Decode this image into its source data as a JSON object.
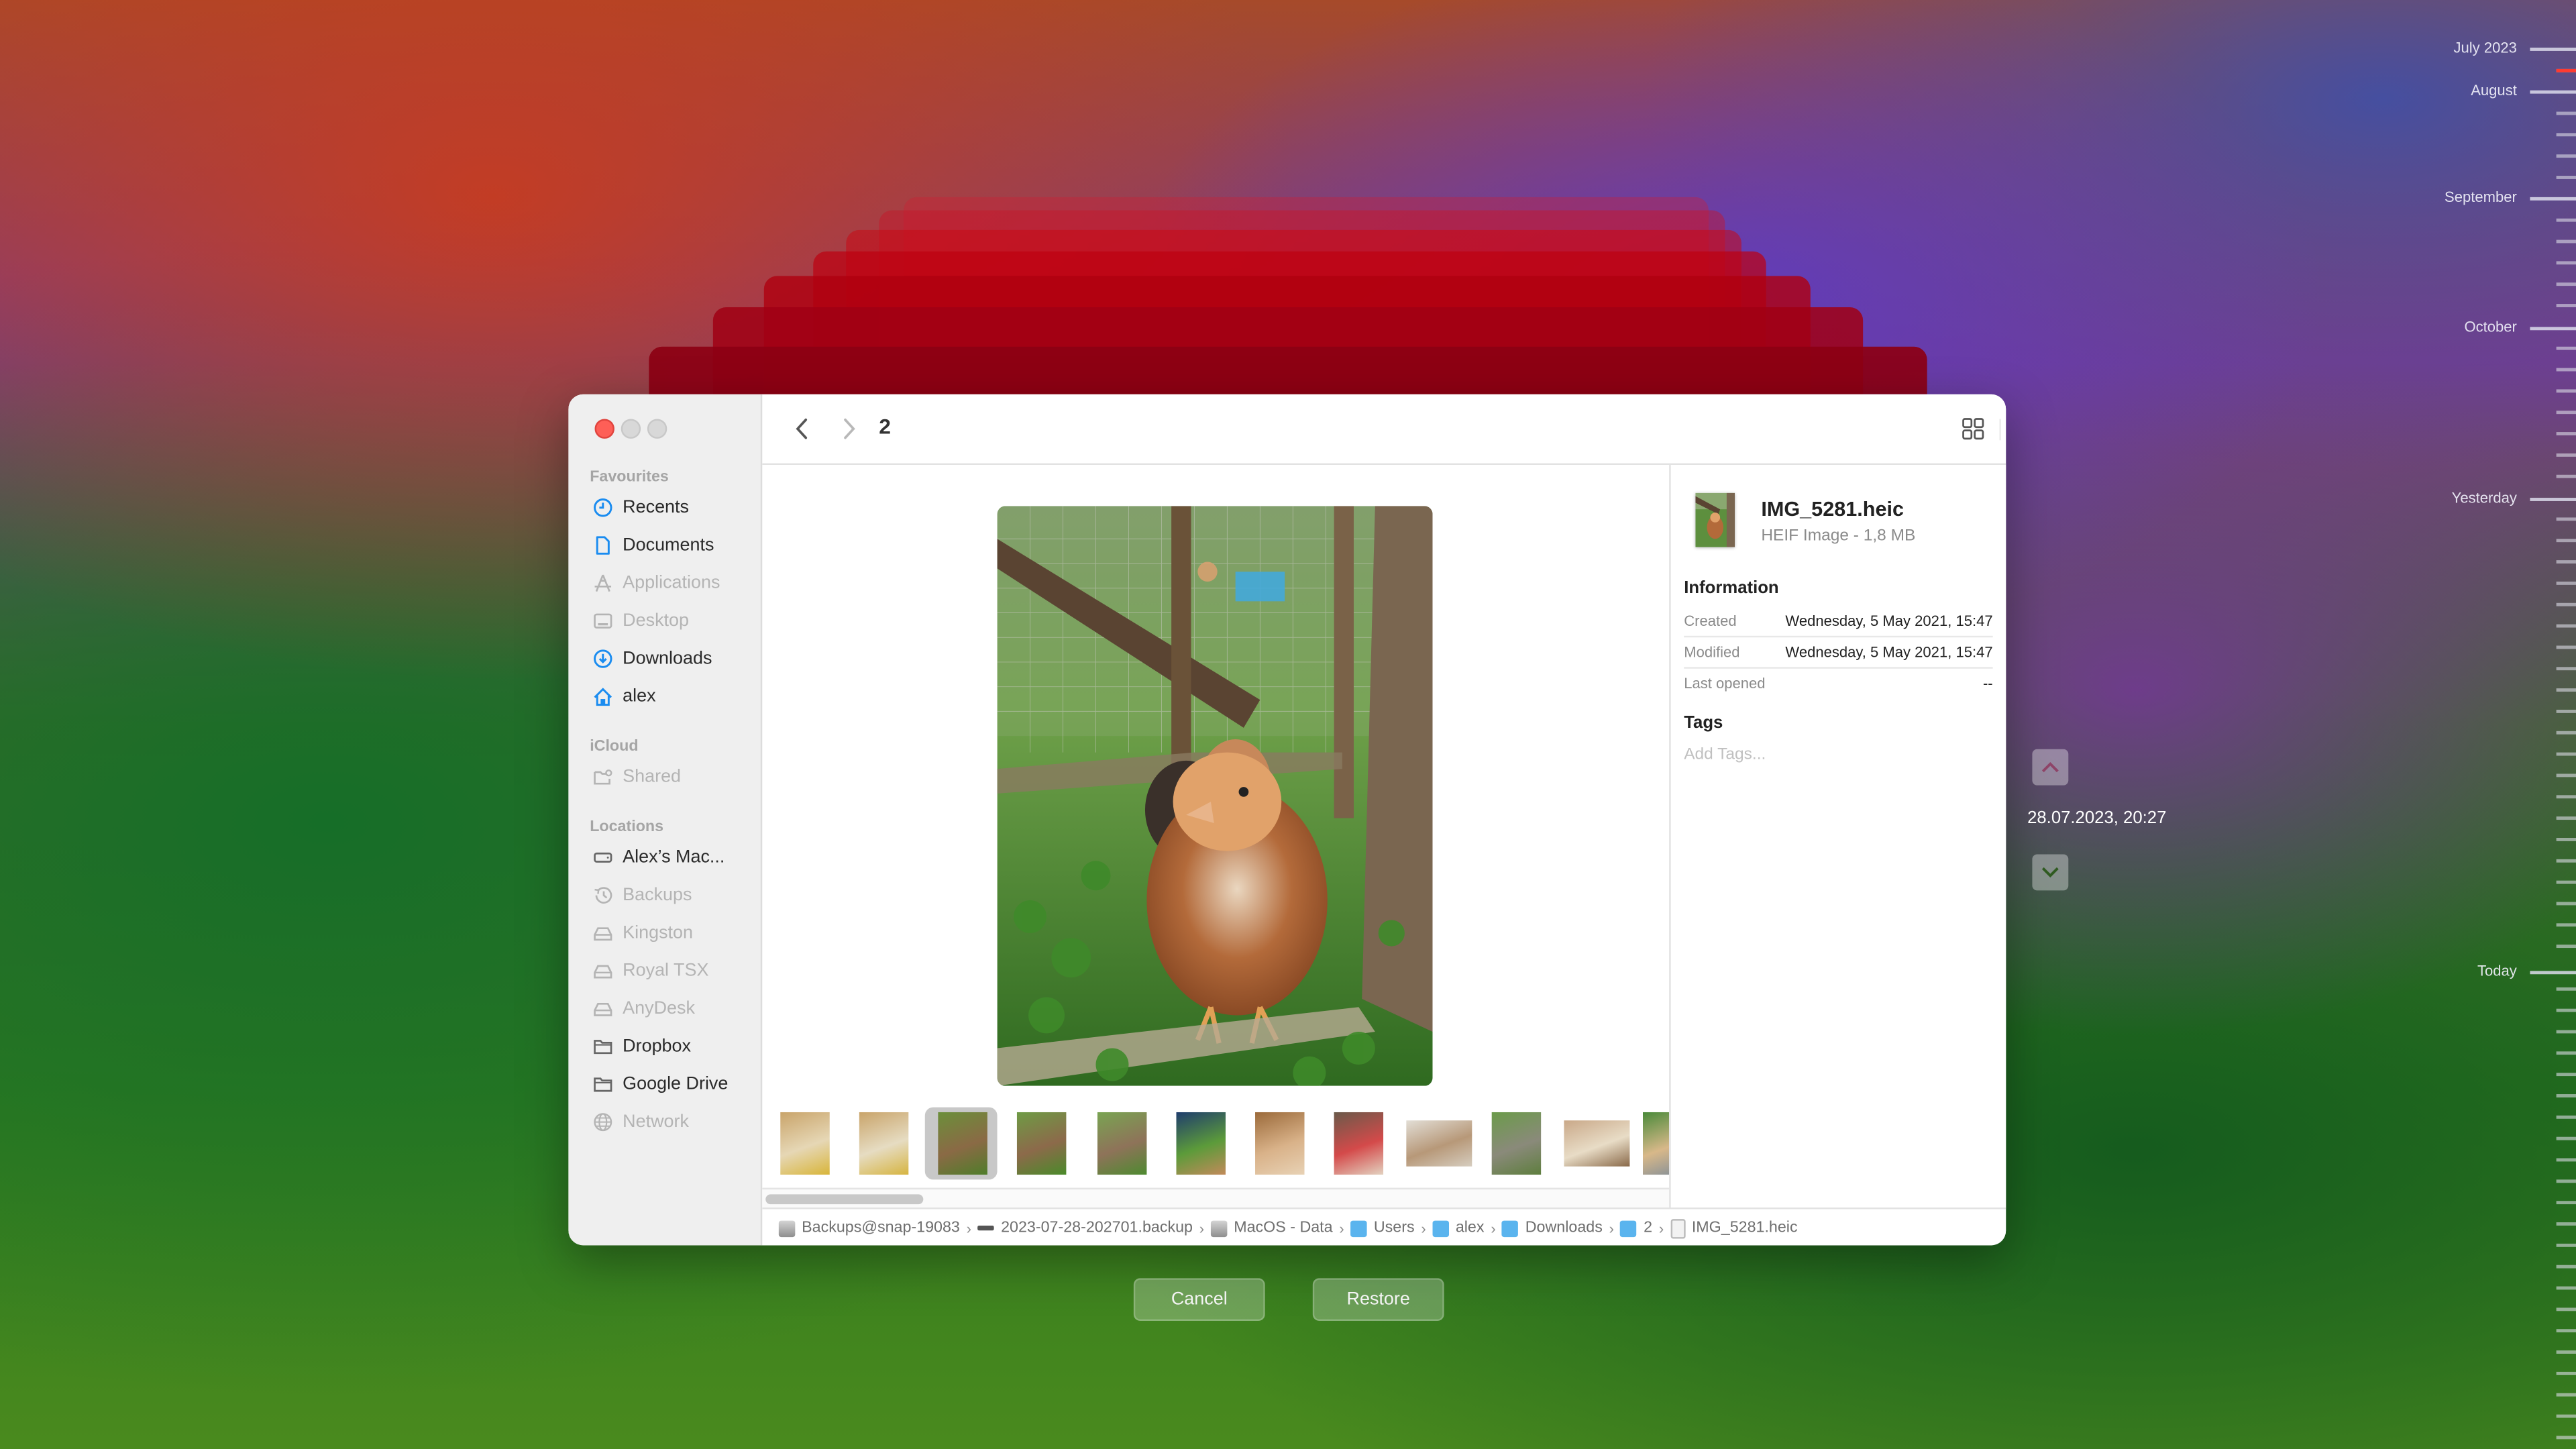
{
  "window": {
    "folder_title": "2",
    "controls": [
      "close",
      "minimize",
      "zoom"
    ]
  },
  "sidebar": {
    "sections": [
      {
        "heading": "Favourites",
        "items": [
          {
            "label": "Recents",
            "icon": "clock-icon",
            "enabled": true
          },
          {
            "label": "Documents",
            "icon": "document-icon",
            "enabled": true
          },
          {
            "label": "Applications",
            "icon": "applications-icon",
            "enabled": false
          },
          {
            "label": "Desktop",
            "icon": "desktop-icon",
            "enabled": false
          },
          {
            "label": "Downloads",
            "icon": "download-icon",
            "enabled": true
          },
          {
            "label": "alex",
            "icon": "home-icon",
            "enabled": true
          }
        ]
      },
      {
        "heading": "iCloud",
        "items": [
          {
            "label": "Shared",
            "icon": "shared-folder-icon",
            "enabled": false
          }
        ]
      },
      {
        "heading": "Locations",
        "items": [
          {
            "label": "Alex’s Mac...",
            "icon": "laptop-drive-icon",
            "enabled": true
          },
          {
            "label": "Backups",
            "icon": "time-machine-icon",
            "enabled": false
          },
          {
            "label": "Kingston",
            "icon": "external-drive-icon",
            "enabled": false
          },
          {
            "label": "Royal TSX",
            "icon": "external-drive-icon",
            "enabled": false
          },
          {
            "label": "AnyDesk",
            "icon": "external-drive-icon",
            "enabled": false
          },
          {
            "label": "Dropbox",
            "icon": "folder-icon",
            "enabled": true
          },
          {
            "label": "Google Drive",
            "icon": "folder-icon",
            "enabled": true
          },
          {
            "label": "Network",
            "icon": "globe-icon",
            "enabled": false
          }
        ]
      }
    ]
  },
  "toolbar": {
    "back": "back-icon",
    "forward": "forward-icon",
    "views": [
      "icon-view",
      "list-view",
      "column-view",
      "gallery-view"
    ],
    "selected_view": "gallery-view",
    "group": "group-by-icon",
    "share": "share-icon",
    "tag": "tag-icon",
    "more": "more-icon",
    "search": "search-icon"
  },
  "gallery": {
    "selected_index": 2,
    "thumbnails": [
      {
        "subject": "cat on bag",
        "colors": [
          "#c9a46a",
          "#e6d7b5",
          "#d8b53a"
        ]
      },
      {
        "subject": "cat on bag",
        "colors": [
          "#c9a46a",
          "#e6dcc2",
          "#d6b441"
        ]
      },
      {
        "subject": "chick in coop",
        "colors": [
          "#6b8f3a",
          "#8a6a45",
          "#4f7d2a"
        ]
      },
      {
        "subject": "chicks in coop",
        "colors": [
          "#6e9b45",
          "#8c6a4a",
          "#4a8a2a"
        ]
      },
      {
        "subject": "chick in coop",
        "colors": [
          "#79a452",
          "#8e7359",
          "#4e8a30"
        ]
      },
      {
        "subject": "chicks on grass",
        "colors": [
          "#1f3d6d",
          "#5c9b3a",
          "#c28a5a"
        ]
      },
      {
        "subject": "kitten",
        "colors": [
          "#9b6a3a",
          "#d9b289",
          "#e8d2b5"
        ]
      },
      {
        "subject": "cat with red toy",
        "colors": [
          "#6a5a4a",
          "#d44a4a",
          "#e3d2c0"
        ]
      },
      {
        "subject": "cat in box",
        "colors": [
          "#e2ded6",
          "#b79878",
          "#d6cdbf"
        ]
      },
      {
        "subject": "chicks on gravel",
        "colors": [
          "#6b9b4a",
          "#8a8a7a",
          "#5e7e3e"
        ]
      },
      {
        "subject": "cat on table",
        "colors": [
          "#c9a888",
          "#e8dcc6",
          "#8a6a4a"
        ]
      },
      {
        "subject": "dog on grass",
        "colors": [
          "#4a8a3a",
          "#d8b889",
          "#7a8a9a"
        ]
      }
    ]
  },
  "info": {
    "file_name": "IMG_5281.heic",
    "kind_size": "HEIF Image - 1,8 MB",
    "information_heading": "Information",
    "rows": [
      {
        "label": "Created",
        "value": "Wednesday, 5 May 2021, 15:47"
      },
      {
        "label": "Modified",
        "value": "Wednesday, 5 May 2021, 15:47"
      },
      {
        "label": "Last opened",
        "value": "--"
      }
    ],
    "tags_heading": "Tags",
    "tags_placeholder": "Add Tags..."
  },
  "pathbar": [
    {
      "label": "Backups@snap-19083",
      "icon": "disk"
    },
    {
      "label": "2023-07-28-202701.backup",
      "icon": "bar"
    },
    {
      "label": "MacOS - Data",
      "icon": "disk"
    },
    {
      "label": "Users",
      "icon": "folder"
    },
    {
      "label": "alex",
      "icon": "folder"
    },
    {
      "label": "Downloads",
      "icon": "folder"
    },
    {
      "label": "2",
      "icon": "folder"
    },
    {
      "label": "IMG_5281.heic",
      "icon": "file"
    }
  ],
  "actions": {
    "cancel": "Cancel",
    "restore": "Restore"
  },
  "time_machine": {
    "current_snapshot": "28.07.2023, 20:27",
    "timeline_labels": [
      "July 2023",
      "August",
      "September",
      "October",
      "Yesterday",
      "Today"
    ],
    "accent_current": "#ff3b30"
  }
}
